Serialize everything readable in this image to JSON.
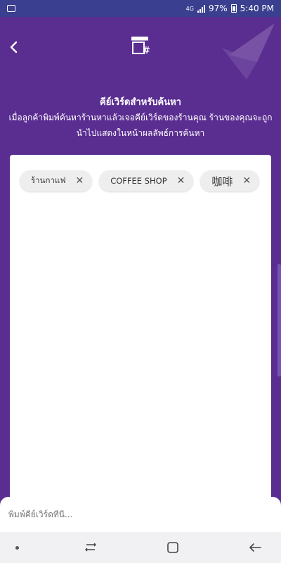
{
  "status_bar": {
    "battery": "97%",
    "time": "5:40 PM",
    "network": "4G"
  },
  "header": {
    "back_icon": "chevron-left-icon",
    "store_icon": "store-hashtag-icon",
    "title": "คีย์เวิร์ดสำหรับค้นหา",
    "subtitle": "เมื่อลูกค้าพิมพ์ค้นหาร้านหาแล้วเจอคีย์เวิร์ดของร้านคุณ ร้านของคุณจะถูกนำไปแสดงในหน้าผลลัพธ์การค้นหา"
  },
  "keywords": [
    {
      "label": "ร้านกาแฟ"
    },
    {
      "label": "COFFEE SHOP"
    },
    {
      "label": "咖啡"
    }
  ],
  "input": {
    "placeholder": "พิมพ์คีย์เวิร์ดที่นี่..."
  },
  "colors": {
    "primary": "#5a2d91",
    "status_bar": "#3b3f8f",
    "chip_bg": "#eeeeee",
    "card_bg": "#ffffff"
  }
}
